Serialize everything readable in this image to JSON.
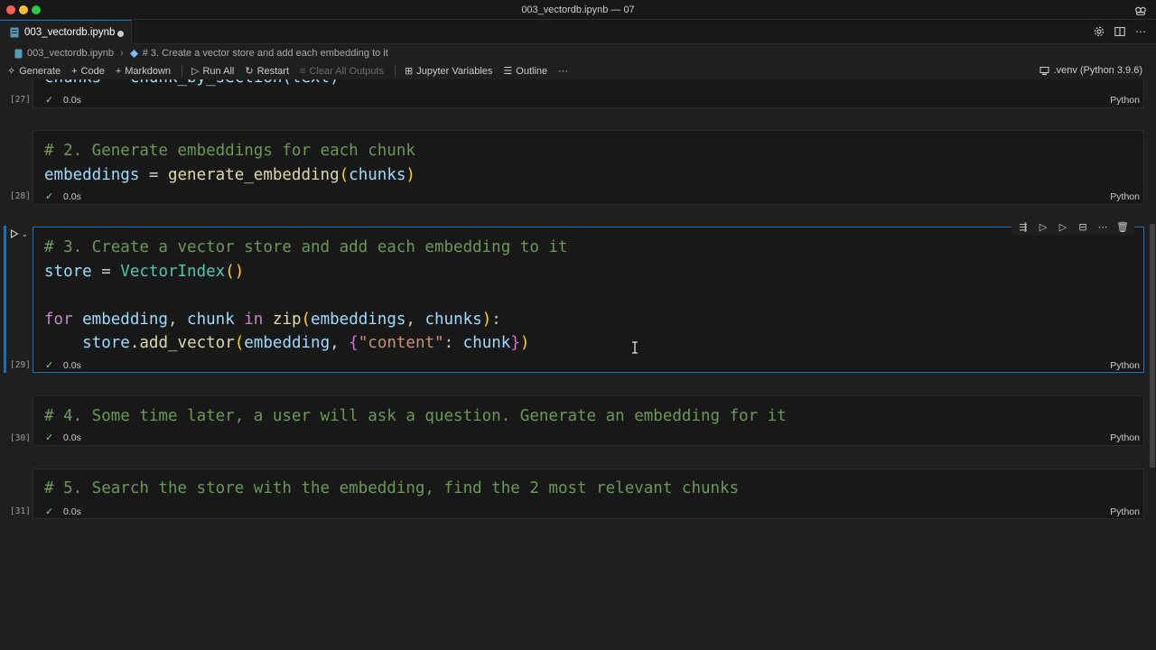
{
  "window": {
    "title": "003_vectordb.ipynb — 07"
  },
  "tab": {
    "label": "003_vectordb.ipynb"
  },
  "breadcrumb": {
    "file": "003_vectordb.ipynb",
    "section": "# 3. Create a vector store and add each embedding to it"
  },
  "toolbar": {
    "generate": "Generate",
    "code": "Code",
    "markdown": "Markdown",
    "run_all": "Run All",
    "restart": "Restart",
    "clear_outputs": "Clear All Outputs",
    "variables": "Jupyter Variables",
    "outline": "Outline",
    "more": "···",
    "kernel": ".venv (Python 3.9.6)"
  },
  "cells": [
    {
      "exec": "[27]",
      "time": "0.0s",
      "lang": "Python",
      "partial_text": "chunks = chunk_by_section(text)"
    },
    {
      "exec": "[28]",
      "time": "0.0s",
      "lang": "Python",
      "line1": {
        "comment": "# 2. Generate embeddings for each chunk"
      },
      "line2": {
        "var": "embeddings",
        "eq": " = ",
        "fn": "generate_embedding",
        "open": "(",
        "arg": "chunks",
        "close": ")"
      }
    },
    {
      "exec": "[29]",
      "time": "0.0s",
      "lang": "Python",
      "line1": {
        "comment": "# 3. Create a vector store and add each embedding to it"
      },
      "line2": {
        "var": "store",
        "eq": " = ",
        "cls": "VectorIndex",
        "parens": "()"
      },
      "line4": {
        "kw_for": "for",
        "v1": " embedding",
        "comma": ", ",
        "v2": "chunk",
        "kw_in": " in ",
        "fn": "zip",
        "open": "(",
        "a1": "embeddings",
        "c2": ", ",
        "a2": "chunks",
        "close": ")",
        "colon": ":"
      },
      "line5": {
        "indent": "    ",
        "obj": "store",
        "dot": ".",
        "fn": "add_vector",
        "open": "(",
        "a1": "embedding",
        "comma": ", ",
        "brace_open": "{",
        "key": "\"content\"",
        "colon": ": ",
        "a2": "chunk",
        "brace_close": "}",
        "close": ")"
      }
    },
    {
      "exec": "[30]",
      "time": "0.0s",
      "lang": "Python",
      "line1": {
        "comment": "# 4. Some time later, a user will ask a question. Generate an embedding for it"
      }
    },
    {
      "exec": "[31]",
      "time": "0.0s",
      "lang": "Python",
      "line1": {
        "comment": "# 5. Search the store with the embedding, find the 2 most relevant chunks"
      }
    }
  ],
  "colors": {
    "accent": "#0078d4",
    "comment": "#6a9955",
    "keyword": "#c586c0",
    "function": "#dcdcaa",
    "class": "#4ec9b0",
    "variable": "#9cdcfe",
    "string": "#ce9178",
    "success": "#89d185"
  },
  "icons": [
    "settings-icon",
    "split-editor-icon",
    "more-icon",
    "run-icon",
    "chevron-down-icon",
    "check-icon"
  ]
}
